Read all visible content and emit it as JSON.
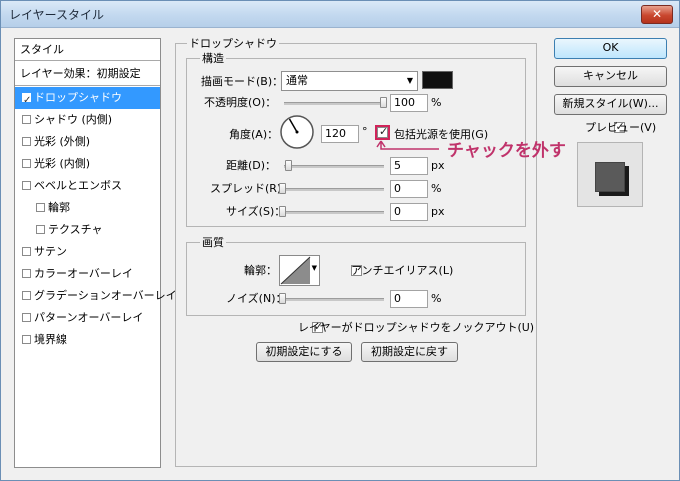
{
  "window": {
    "title": "レイヤースタイル",
    "close_label": "✕"
  },
  "style_list": {
    "header": "スタイル",
    "blend_options": "レイヤー効果：初期設定",
    "items": [
      {
        "label": "ドロップシャドウ",
        "checked": true,
        "selected": true,
        "indent": false
      },
      {
        "label": "シャドウ (内側)",
        "checked": false,
        "indent": false
      },
      {
        "label": "光彩 (外側)",
        "checked": false,
        "indent": false
      },
      {
        "label": "光彩 (内側)",
        "checked": false,
        "indent": false
      },
      {
        "label": "ベベルとエンボス",
        "checked": false,
        "indent": false
      },
      {
        "label": "輪郭",
        "checked": false,
        "indent": true
      },
      {
        "label": "テクスチャ",
        "checked": false,
        "indent": true
      },
      {
        "label": "サテン",
        "checked": false,
        "indent": false
      },
      {
        "label": "カラーオーバーレイ",
        "checked": false,
        "indent": false
      },
      {
        "label": "グラデーションオーバーレイ",
        "checked": false,
        "indent": false
      },
      {
        "label": "パターンオーバーレイ",
        "checked": false,
        "indent": false
      },
      {
        "label": "境界線",
        "checked": false,
        "indent": false
      }
    ]
  },
  "drop_shadow": {
    "group_title": "ドロップシャドウ",
    "structure": {
      "title": "構造",
      "blend_mode_label": "描画モード(B)：",
      "blend_mode_value": "通常",
      "shadow_color": "#111111",
      "opacity_label": "不透明度(O)：",
      "opacity_value": "100",
      "opacity_fraction": 1.0,
      "opacity_unit": "%",
      "angle_label": "角度(A)：",
      "angle_value": "120",
      "angle_unit": "°",
      "global_light_label": "包括光源を使用(G)",
      "global_light_checked": true,
      "distance_label": "距離(D)：",
      "distance_value": "5",
      "distance_unit": "px",
      "spread_label": "スプレッド(R)：",
      "spread_value": "0",
      "spread_unit": "%",
      "size_label": "サイズ(S)：",
      "size_value": "0",
      "size_unit": "px"
    },
    "quality": {
      "title": "画質",
      "contour_label": "輪郭：",
      "anti_alias_label": "アンチエイリアス(L)",
      "anti_alias_checked": false,
      "noise_label": "ノイズ(N)：",
      "noise_value": "0",
      "noise_unit": "%"
    },
    "knockout_label": "レイヤーがドロップシャドウをノックアウト(U)",
    "knockout_checked": true,
    "make_default_label": "初期設定にする",
    "reset_default_label": "初期設定に戻す"
  },
  "annotation": {
    "text": "チャックを外す",
    "color": "#c0336b"
  },
  "buttons": {
    "ok": "OK",
    "cancel": "キャンセル",
    "new_style": "新規スタイル(W)...",
    "preview_label": "プレビュー(V)",
    "preview_checked": true
  }
}
